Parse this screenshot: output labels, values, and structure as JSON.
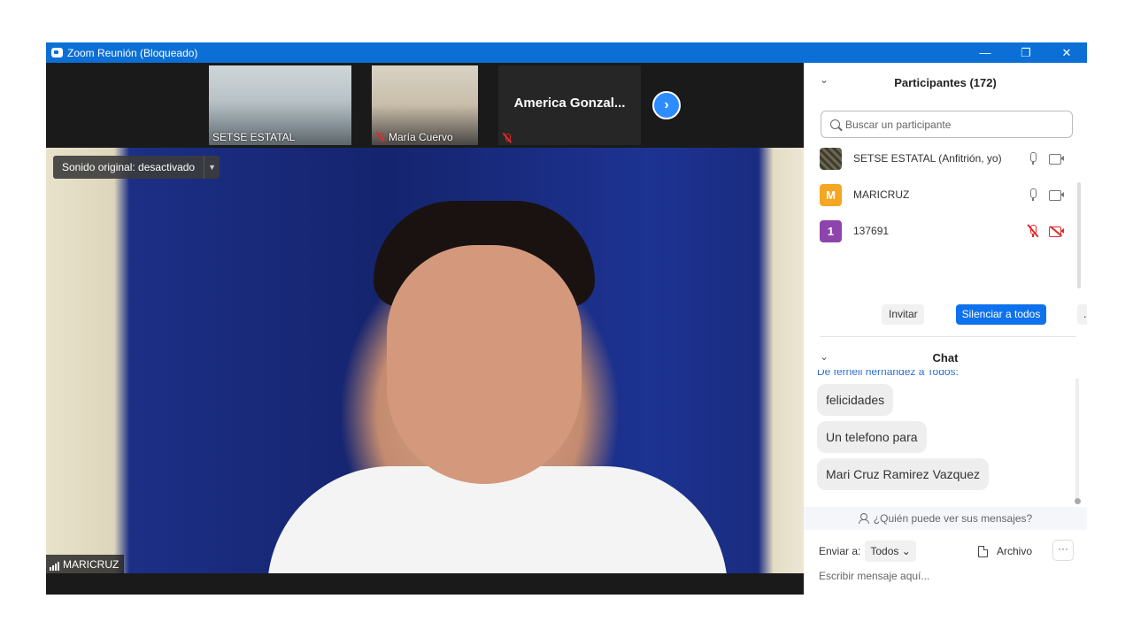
{
  "window": {
    "title": "Zoom Reunión (Bloqueado)",
    "controls": {
      "minimize": "—",
      "restore": "❐",
      "close": "✕"
    }
  },
  "thumbnails": [
    {
      "name": "SETSE ESTATAL",
      "muted": false
    },
    {
      "name": "María Cuervo",
      "muted": true
    },
    {
      "name": "America  Gonzal...",
      "muted": true
    }
  ],
  "next_page_icon": "chevron-right-icon",
  "main_video": {
    "sound_label": "Sonido original: desactivado",
    "speaker_name": "MARICRUZ"
  },
  "participants": {
    "title": "Participantes (172)",
    "search_placeholder": "Buscar un participante",
    "list": [
      {
        "name": "SETSE ESTATAL (Anfitrión, yo)",
        "avatar_letter": "",
        "avatar_color": "#5a5a4a",
        "mic_muted": false,
        "cam_muted": false
      },
      {
        "name": "MARICRUZ",
        "avatar_letter": "M",
        "avatar_color": "#f5a623",
        "mic_muted": false,
        "cam_muted": false
      },
      {
        "name": "137691",
        "avatar_letter": "1",
        "avatar_color": "#8e44ad",
        "mic_muted": true,
        "cam_muted": true
      }
    ],
    "invite_label": "Invitar",
    "mute_all_label": "Silenciar a todos",
    "more_label": "..."
  },
  "chat": {
    "title": "Chat",
    "from_line": "De fernell hernández a Todos:",
    "messages": [
      "felicidades",
      "Un telefono para",
      "Mari Cruz Ramirez Vazquez"
    ],
    "who_can_see": "¿Quién puede ver sus mensajes?",
    "send_to_label": "Enviar a:",
    "send_to_value": "Todos",
    "file_label": "Archivo",
    "more_label": "···",
    "input_placeholder": "Escribir mensaje aquí..."
  },
  "colors": {
    "titlebar": "#0b6fd6",
    "primary_button": "#0e72ed",
    "muted_red": "#e02828"
  }
}
